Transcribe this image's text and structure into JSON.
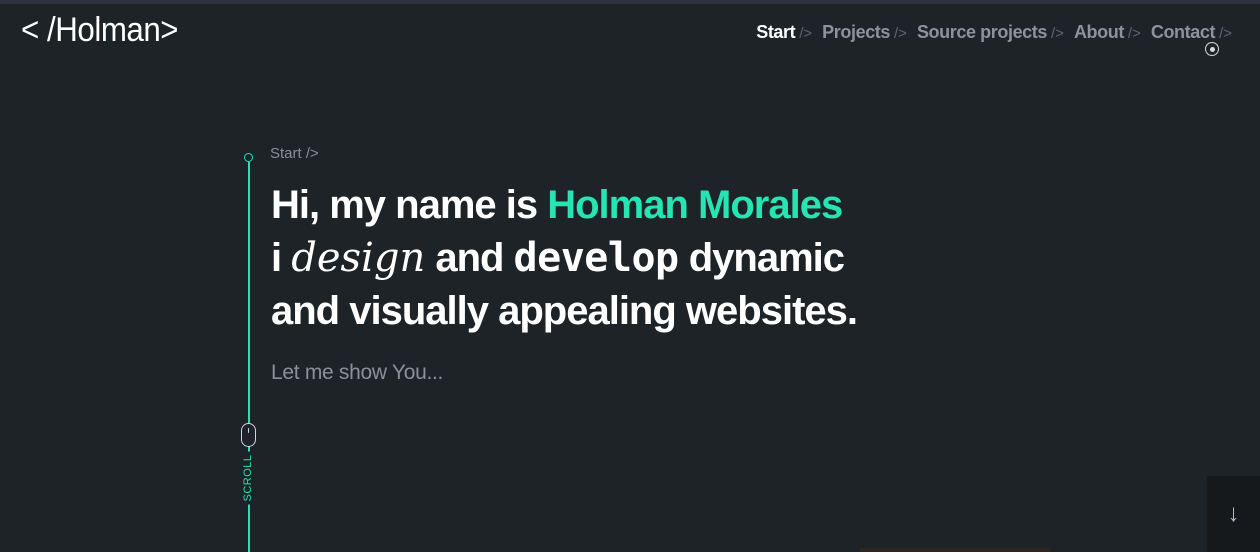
{
  "header": {
    "logo": "< /Holman>",
    "nav": [
      {
        "label": "Start",
        "sep": "/>",
        "active": true
      },
      {
        "label": "Projects",
        "sep": "/>",
        "active": false
      },
      {
        "label": "Source projects",
        "sep": "/>",
        "active": false
      },
      {
        "label": "About",
        "sep": "/>",
        "active": false
      },
      {
        "label": "Contact",
        "sep": "/>",
        "active": false
      }
    ]
  },
  "hero": {
    "breadcrumb": "Start />",
    "line1_prefix": "Hi, my name is ",
    "line1_name": "Holman Morales",
    "line2_i": "i ",
    "line2_design": "design",
    "line2_and": " and ",
    "line2_develop": "develop",
    "line2_rest": " dynamic",
    "line3": "and visually appealing websites.",
    "subtitle": "Let me show You..."
  },
  "timeline": {
    "scroll_label": "SCROLL"
  },
  "scroll_button": {
    "arrow": "↓"
  },
  "colors": {
    "accent": "#27e5b3",
    "background": "#1e2327"
  }
}
